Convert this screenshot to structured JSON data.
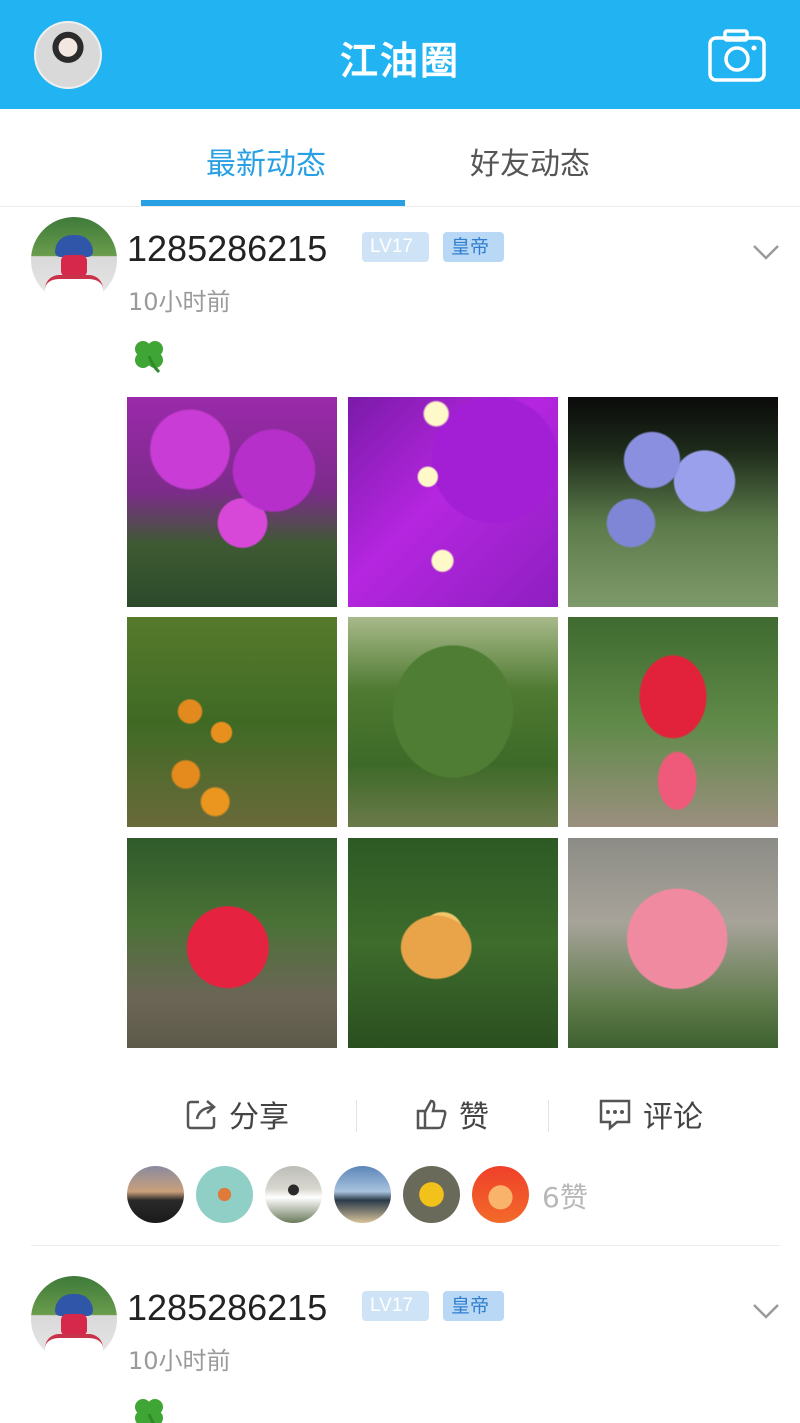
{
  "header": {
    "title": "江油圈",
    "avatar_icon": "user-avatar",
    "camera_icon": "camera-icon",
    "background_color": "#22b3f2"
  },
  "tabs": [
    {
      "label": "最新动态",
      "active": true
    },
    {
      "label": "好友动态",
      "active": false
    }
  ],
  "accent_color": "#2aa0e4",
  "posts": [
    {
      "username": "1285286215",
      "level": "LV17",
      "rank": "皇帝",
      "timestamp": "10小时前",
      "content_icon": "four-leaf-clover-icon",
      "photos": [
        {
          "subject": "magenta bougainvillea bush"
        },
        {
          "subject": "purple bougainvillea close-up"
        },
        {
          "subject": "lavender flowering shrub"
        },
        {
          "subject": "orange tree with fruit"
        },
        {
          "subject": "mandarin orange tree"
        },
        {
          "subject": "red hanging bud flower"
        },
        {
          "subject": "red rose"
        },
        {
          "subject": "yellow-orange flower bud"
        },
        {
          "subject": "pink rose"
        }
      ],
      "actions": {
        "share": "分享",
        "like": "赞",
        "comment": "评论"
      },
      "likers_count": 6,
      "likes_label": "6赞"
    },
    {
      "username": "1285286215",
      "level": "LV17",
      "rank": "皇帝",
      "timestamp": "10小时前",
      "content_icon": "four-leaf-clover-icon"
    }
  ]
}
